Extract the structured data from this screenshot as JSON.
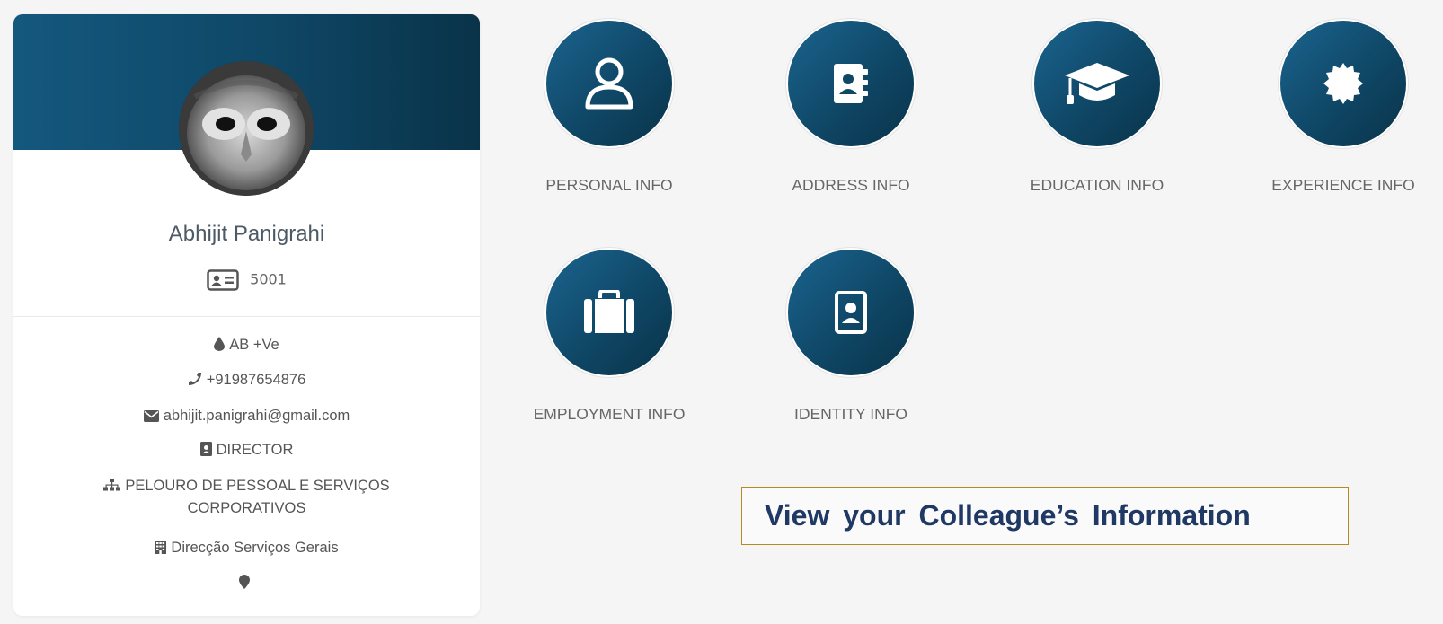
{
  "profile": {
    "name": "Abhijit Panigrahi",
    "employee_id": "5001",
    "blood_group": "AB +Ve",
    "phone": "+91987654876",
    "email": "abhijit.panigrahi@gmail.com",
    "designation": "DIRECTOR",
    "department_line1": "PELOURO DE PESSOAL E SERVIÇOS",
    "department_line2": "CORPORATIVOS",
    "division": "Direcção Serviços Gerais",
    "location": ""
  },
  "tiles": [
    {
      "label": "PERSONAL INFO",
      "icon": "user-icon"
    },
    {
      "label": "ADDRESS INFO",
      "icon": "address-book-icon"
    },
    {
      "label": "EDUCATION INFO",
      "icon": "graduation-cap-icon"
    },
    {
      "label": "EXPERIENCE INFO",
      "icon": "certificate-icon"
    },
    {
      "label": "EMPLOYMENT INFO",
      "icon": "briefcase-icon"
    },
    {
      "label": "IDENTITY INFO",
      "icon": "id-badge-icon"
    }
  ],
  "callout": {
    "text": "View your Colleague’s Information"
  },
  "colors": {
    "banner": "#0f4766",
    "circle": "#0f4766",
    "callout_text": "#1f3864",
    "callout_border": "#b58a1f"
  }
}
